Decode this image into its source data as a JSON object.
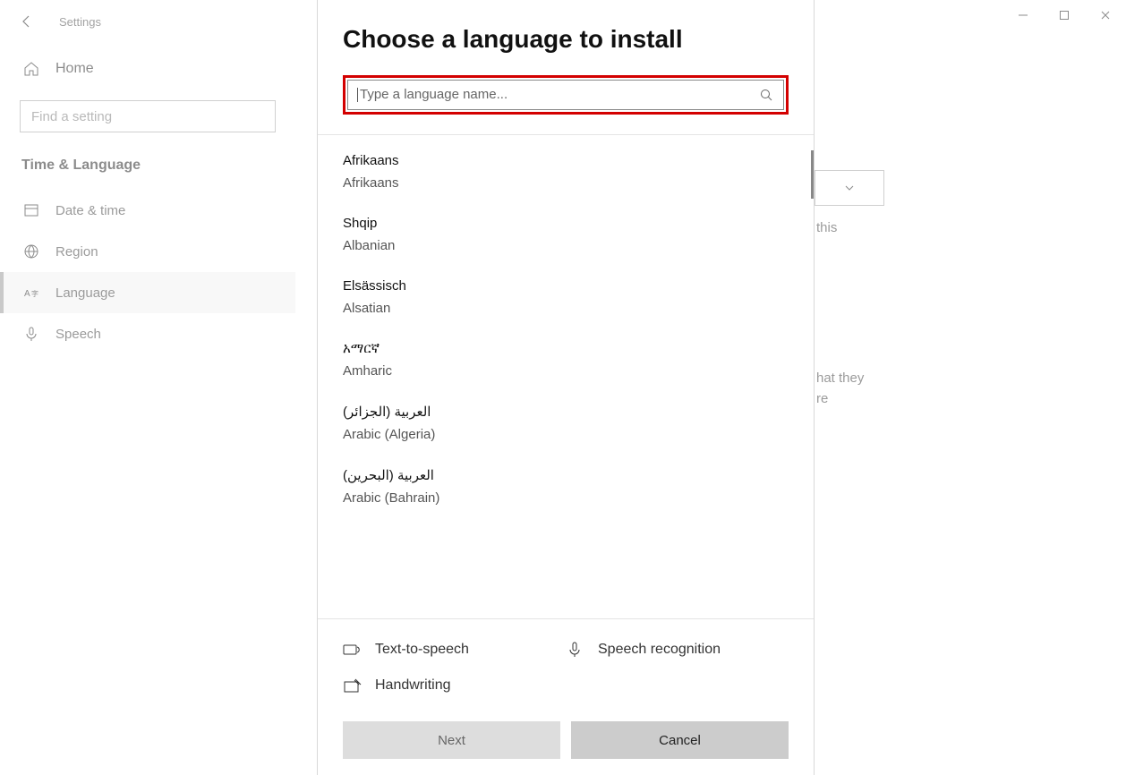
{
  "window": {
    "title": "Settings",
    "controls": {
      "minimize": "−",
      "maximize": "□",
      "close": "✕"
    }
  },
  "sidebar": {
    "home": "Home",
    "search_placeholder": "Find a setting",
    "section": "Time & Language",
    "items": [
      {
        "label": "Date & time"
      },
      {
        "label": "Region"
      },
      {
        "label": "Language"
      },
      {
        "label": "Speech"
      }
    ],
    "active_index": 2
  },
  "background_fragments": {
    "right_text_1": "this",
    "right_text_2a": "hat they",
    "right_text_2b": "re"
  },
  "dialog": {
    "title": "Choose a language to install",
    "search_placeholder": "Type a language name...",
    "languages": [
      {
        "native": "Afrikaans",
        "local": "Afrikaans"
      },
      {
        "native": "Shqip",
        "local": "Albanian"
      },
      {
        "native": "Elsässisch",
        "local": "Alsatian"
      },
      {
        "native": "አማርኛ",
        "local": "Amharic"
      },
      {
        "native": "العربية (الجزائر)",
        "local": "Arabic (Algeria)"
      },
      {
        "native": "العربية (البحرين)",
        "local": "Arabic (Bahrain)"
      }
    ],
    "features": {
      "tts": "Text-to-speech",
      "speech": "Speech recognition",
      "handwriting": "Handwriting"
    },
    "buttons": {
      "next": "Next",
      "cancel": "Cancel"
    }
  }
}
